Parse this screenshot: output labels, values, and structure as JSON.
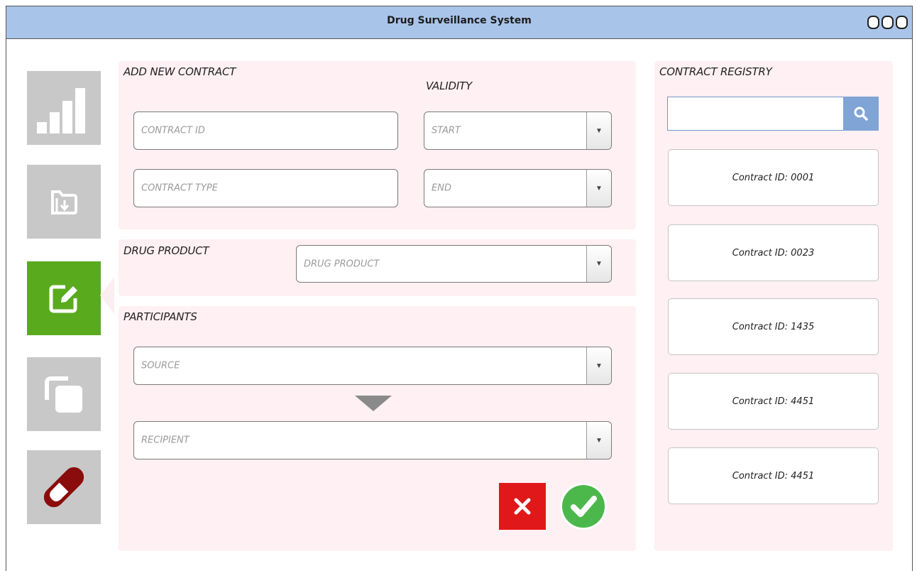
{
  "window": {
    "title": "Drug Surveillance System"
  },
  "sidebar": {
    "items": [
      {
        "name": "statistics",
        "icon": "bar-chart-icon",
        "active": false
      },
      {
        "name": "import",
        "icon": "folder-import-icon",
        "active": false
      },
      {
        "name": "contracts",
        "icon": "edit-icon",
        "active": true
      },
      {
        "name": "copy",
        "icon": "copy-icon",
        "active": false
      },
      {
        "name": "drugs",
        "icon": "pill-icon",
        "active": false
      }
    ],
    "active_color": "#5aaa1e"
  },
  "add_contract": {
    "heading": "ADD NEW CONTRACT",
    "validity_label": "VALIDITY",
    "contract_id_placeholder": "CONTRACT ID",
    "contract_type_placeholder": "CONTRACT TYPE",
    "start_placeholder": "START",
    "end_placeholder": "END"
  },
  "drug_product": {
    "label": "DRUG PRODUCT",
    "placeholder": "DRUG PRODUCT"
  },
  "participants": {
    "label": "PARTICIPANTS",
    "source_placeholder": "SOURCE",
    "recipient_placeholder": "RECIPIENT"
  },
  "actions": {
    "cancel_icon": "close-icon",
    "confirm_icon": "check-icon",
    "cancel_color": "#e0181a",
    "confirm_color": "#4cb84c"
  },
  "registry": {
    "heading": "CONTRACT REGISTRY",
    "search_value": "",
    "search_icon": "search-icon",
    "items": [
      {
        "label": "Contract ID: 0001"
      },
      {
        "label": "Contract ID: 0023"
      },
      {
        "label": "Contract ID: 1435"
      },
      {
        "label": "Contract ID: 4451"
      },
      {
        "label": "Contract ID: 4451"
      }
    ]
  }
}
